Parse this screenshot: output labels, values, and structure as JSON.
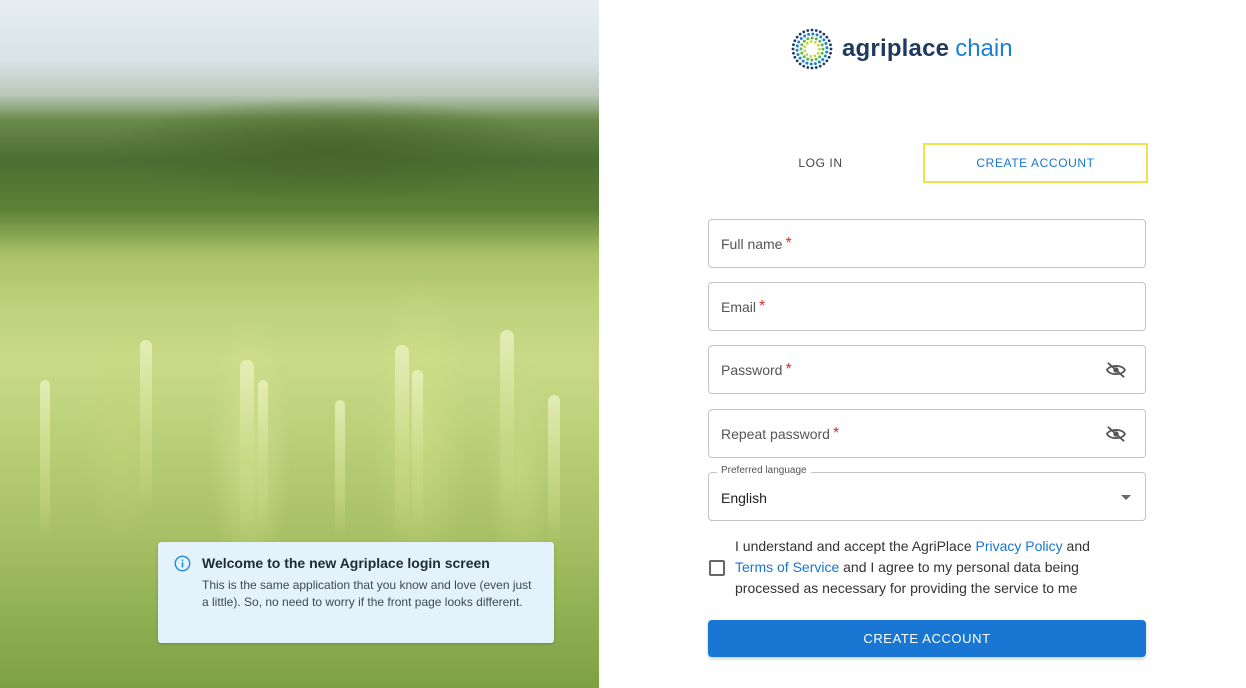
{
  "brand": {
    "name": "agriplace",
    "sub": "chain",
    "logo_icon": "dotted-sunburst-logo-icon",
    "colors": {
      "primary": "#1e3a5f",
      "accent": "#1f7fd1"
    }
  },
  "info": {
    "icon": "info-circle-icon",
    "title": "Welcome to the new Agriplace login screen",
    "text": "This is the same application that you know and love (even just a little). So, no need to worry if the front page looks different."
  },
  "tabs": {
    "login": "LOG IN",
    "create": "CREATE ACCOUNT",
    "active": "create"
  },
  "form": {
    "full_name": {
      "label": "Full name",
      "required": "*"
    },
    "email": {
      "label": "Email",
      "required": "*"
    },
    "password": {
      "label": "Password",
      "required": "*",
      "icon": "eye-off-icon"
    },
    "repeat_password": {
      "label": "Repeat password",
      "required": "*",
      "icon": "eye-off-icon"
    },
    "language": {
      "label": "Preferred language",
      "value": "English"
    },
    "consent": {
      "part1": "I understand and accept the AgriPlace ",
      "privacy": "Privacy Policy",
      "part2": " and ",
      "terms": "Terms of Service",
      "part3": " and I agree to my personal data being processed as necessary for providing the service to me",
      "checked": false
    },
    "submit": "CREATE ACCOUNT"
  },
  "colors": {
    "button": "#1976d2",
    "focus_outline": "#f1e14a",
    "info_bg": "#e3f2fb"
  }
}
